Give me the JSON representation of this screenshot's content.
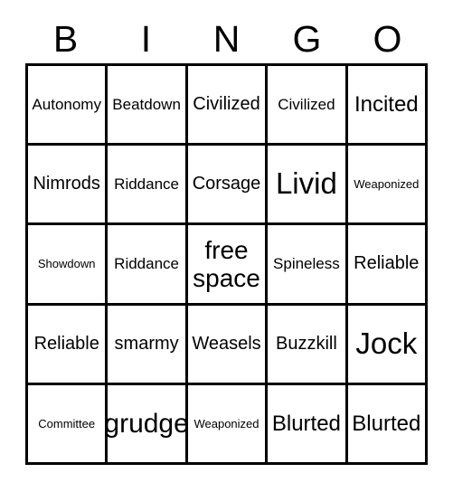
{
  "card": {
    "title": "Bingo Card",
    "free_space_label": "free\nspace",
    "header": {
      "letters": [
        "B",
        "I",
        "N",
        "G",
        "O"
      ]
    },
    "colors": {
      "background": "#ffffff",
      "border": "#000000",
      "text": "#000000"
    },
    "grid": {
      "rows": 5,
      "columns": 5,
      "cells": [
        [
          {
            "text": "Autonomy",
            "size": "sm",
            "free": false
          },
          {
            "text": "Beatdown",
            "size": "sm",
            "free": false
          },
          {
            "text": "Civilized",
            "size": "md",
            "free": false
          },
          {
            "text": "Civilized",
            "size": "sm",
            "free": false
          },
          {
            "text": "Incited",
            "size": "lg",
            "free": false
          }
        ],
        [
          {
            "text": "Nimrods",
            "size": "md",
            "free": false
          },
          {
            "text": "Riddance",
            "size": "sm",
            "free": false
          },
          {
            "text": "Corsage",
            "size": "md",
            "free": false
          },
          {
            "text": "Livid",
            "size": "xxl",
            "free": false
          },
          {
            "text": "Weaponized",
            "size": "xs",
            "free": false
          }
        ],
        [
          {
            "text": "Showdown",
            "size": "xs",
            "free": false
          },
          {
            "text": "Riddance",
            "size": "sm",
            "free": false
          },
          {
            "text": "free\nspace",
            "size": "xl",
            "free": true
          },
          {
            "text": "Spineless",
            "size": "sm",
            "free": false
          },
          {
            "text": "Reliable",
            "size": "md",
            "free": false
          }
        ],
        [
          {
            "text": "Reliable",
            "size": "md",
            "free": false
          },
          {
            "text": "smarmy",
            "size": "md",
            "free": false
          },
          {
            "text": "Weasels",
            "size": "md",
            "free": false
          },
          {
            "text": "Buzzkill",
            "size": "md",
            "free": false
          },
          {
            "text": "Jock",
            "size": "xxl",
            "free": false
          }
        ],
        [
          {
            "text": "Committee",
            "size": "xs",
            "free": false
          },
          {
            "text": "grudge",
            "size": "xl",
            "free": false
          },
          {
            "text": "Weaponized",
            "size": "xs",
            "free": false
          },
          {
            "text": "Blurted",
            "size": "lg",
            "free": false
          },
          {
            "text": "Blurted",
            "size": "lg",
            "free": false
          }
        ]
      ]
    }
  }
}
